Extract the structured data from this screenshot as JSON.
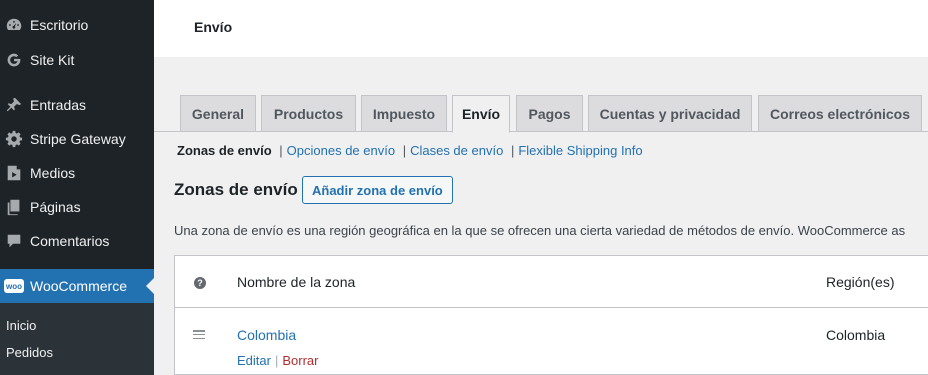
{
  "sidebar": {
    "items": [
      {
        "label": "Escritorio",
        "icon": "dashboard-icon"
      },
      {
        "label": "Site Kit",
        "icon": "google-g-icon"
      },
      {
        "label": "Entradas",
        "icon": "pin-icon"
      },
      {
        "label": "Stripe Gateway",
        "icon": "gear-icon"
      },
      {
        "label": "Medios",
        "icon": "media-icon"
      },
      {
        "label": "Páginas",
        "icon": "pages-icon"
      },
      {
        "label": "Comentarios",
        "icon": "comment-icon"
      },
      {
        "label": "WooCommerce",
        "icon": "woo-icon"
      }
    ],
    "woo_icon_text": "woo",
    "submenu": [
      {
        "label": "Inicio"
      },
      {
        "label": "Pedidos"
      }
    ]
  },
  "header": {
    "title": "Envío"
  },
  "tabs": [
    {
      "label": "General"
    },
    {
      "label": "Productos"
    },
    {
      "label": "Impuesto"
    },
    {
      "label": "Envío"
    },
    {
      "label": "Pagos"
    },
    {
      "label": "Cuentas y privacidad"
    },
    {
      "label": "Correos electrónicos"
    }
  ],
  "subnav": {
    "current": "Zonas de envío",
    "links": [
      "Opciones de envío",
      "Clases de envío",
      "Flexible Shipping Info"
    ],
    "separator": "|"
  },
  "section": {
    "title": "Zonas de envío",
    "add_button": "Añadir zona de envío",
    "description": "Una zona de envío es una región geográfica en la que se ofrecen una cierta variedad de métodos de envío. WooCommerce as"
  },
  "table": {
    "help_icon": "?",
    "columns": [
      "Nombre de la zona",
      "Región(es)"
    ],
    "rows": [
      {
        "name": "Colombia",
        "region": "Colombia",
        "actions": {
          "edit": "Editar",
          "separator": "|",
          "delete": "Borrar"
        }
      }
    ]
  },
  "colors": {
    "sidebar_bg": "#1d2327",
    "accent": "#2271b1",
    "delete": "#b32d2e"
  }
}
